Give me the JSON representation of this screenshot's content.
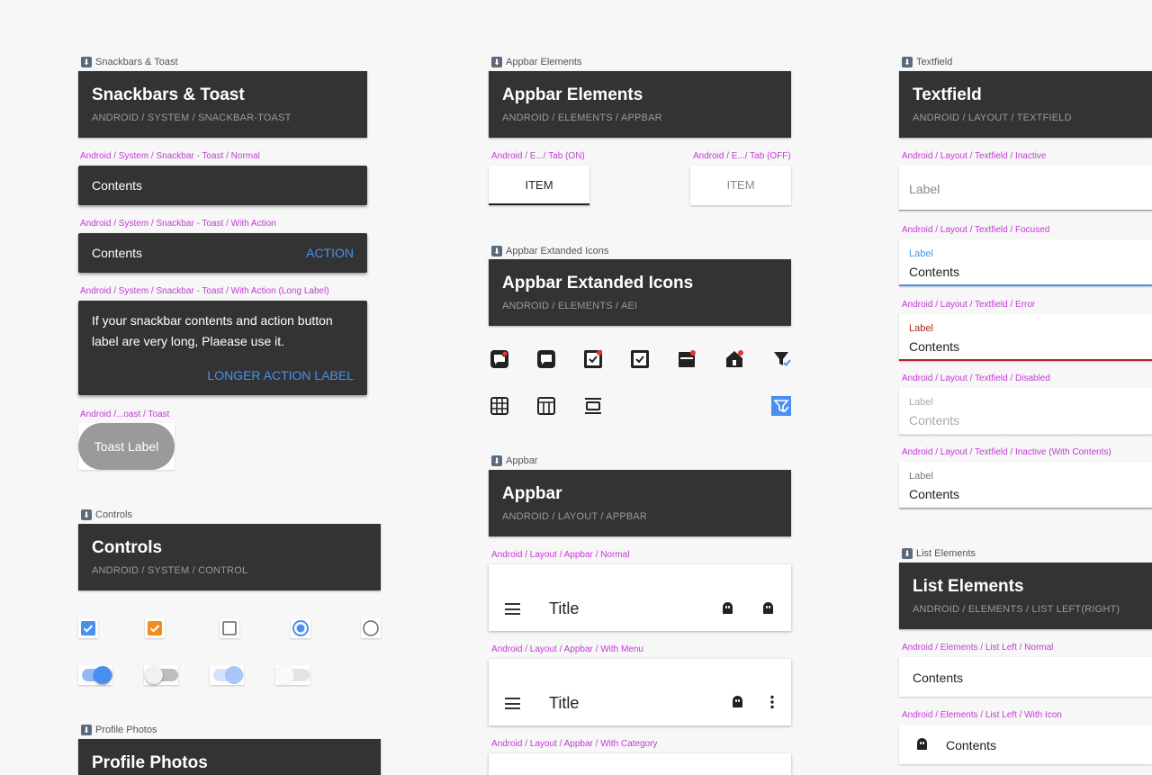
{
  "colors": {
    "accent": "#4a8ff0",
    "label": "#c23bd4",
    "header_bg": "#333333",
    "checkbox_orange": "#f28b1e",
    "error": "#b3261e"
  },
  "snack_section": {
    "section_label": "Snackbars & Toast",
    "title": "Snackbars & Toast",
    "path": "ANDROID / SYSTEM / SNACKBAR-TOAST",
    "normal": {
      "label": "Android / System / Snackbar - Toast / Normal",
      "contents": "Contents"
    },
    "with_action": {
      "label": "Android / System / Snackbar - Toast / With Action",
      "contents": "Contents",
      "action": "ACTION"
    },
    "long": {
      "label": "Android / System / Snackbar - Toast / With Action (Long Label)",
      "line1": "If your snackbar contents and action button",
      "line2": "label are very long, Plaease use it.",
      "action": "LONGER ACTION LABEL"
    },
    "toast": {
      "label": "Android /...oast / Toast",
      "text": "Toast Label"
    }
  },
  "controls_section": {
    "section_label": "Controls",
    "title": "Controls",
    "path": "ANDROID / SYSTEM / CONTROL",
    "checkboxes": [
      {
        "state": "checked",
        "color": "#4a8ff0"
      },
      {
        "state": "checked",
        "color": "#f28b1e"
      },
      {
        "state": "unchecked"
      }
    ],
    "radios": [
      {
        "state": "selected"
      },
      {
        "state": "unselected"
      }
    ],
    "toggles": [
      {
        "state": "on"
      },
      {
        "state": "off"
      },
      {
        "state": "on-disabled"
      },
      {
        "state": "off-disabled"
      }
    ]
  },
  "profile_section": {
    "section_label": "Profile Photos",
    "title": "Profile Photos"
  },
  "appbar_elements": {
    "section_label": "Appbar Elements",
    "title": "Appbar Elements",
    "path": "ANDROID / ELEMENTS / APPBAR",
    "tab_on": {
      "label": "Android / E.../ Tab (ON)",
      "text": "ITEM"
    },
    "tab_off": {
      "label": "Android / E.../ Tab (OFF)",
      "text": "ITEM"
    }
  },
  "appbar_icons": {
    "section_label": "Appbar Extanded Icons",
    "title": "Appbar Extanded Icons",
    "path": "ANDROID / ELEMENTS / AEI",
    "row1": [
      "chat-bubble-alert-icon",
      "chat-bubble-icon",
      "checkbox-alert-icon",
      "checkbox-icon",
      "calendar-alert-icon",
      "home-alert-icon",
      "filter-check-icon"
    ],
    "row2": [
      "grid-icon",
      "table-icon",
      "carousel-icon",
      "filter-check-selected-icon"
    ]
  },
  "appbar_section": {
    "section_label": "Appbar",
    "title": "Appbar",
    "path": "ANDROID / LAYOUT / APPBAR",
    "normal": {
      "label": "Android / Layout / Appbar / Normal",
      "title": "Title"
    },
    "with_menu": {
      "label": "Android / Layout / Appbar / With Menu",
      "title": "Title"
    },
    "with_category": {
      "label": "Android / Layout / Appbar / With Category"
    }
  },
  "textfield_section": {
    "section_label": "Textfield",
    "title": "Textfield",
    "path": "ANDROID / LAYOUT / TEXTFIELD",
    "inactive": {
      "label": "Android / Layout / Textfield / Inactive",
      "placeholder": "Label"
    },
    "focused": {
      "label": "Android / Layout / Textfield / Focused",
      "field_label": "Label",
      "value": "Contents"
    },
    "error": {
      "label": "Android / Layout / Textfield / Error",
      "field_label": "Label",
      "value": "Contents"
    },
    "disabled": {
      "label": "Android / Layout / Textfield / Disabled",
      "field_label": "Label",
      "value": "Contents"
    },
    "inactive_contents": {
      "label": "Android / Layout / Textfield / Inactive (With Contents)",
      "field_label": "Label",
      "value": "Contents"
    }
  },
  "list_section": {
    "section_label": "List Elements",
    "title": "List Elements",
    "path": "ANDROID / ELEMENTS / LIST LEFT(RIGHT)",
    "normal": {
      "label": "Android / Elements / List Left / Normal",
      "contents": "Contents"
    },
    "with_icon": {
      "label": "Android / Elements / List Left / With Icon",
      "contents": "Contents"
    }
  }
}
